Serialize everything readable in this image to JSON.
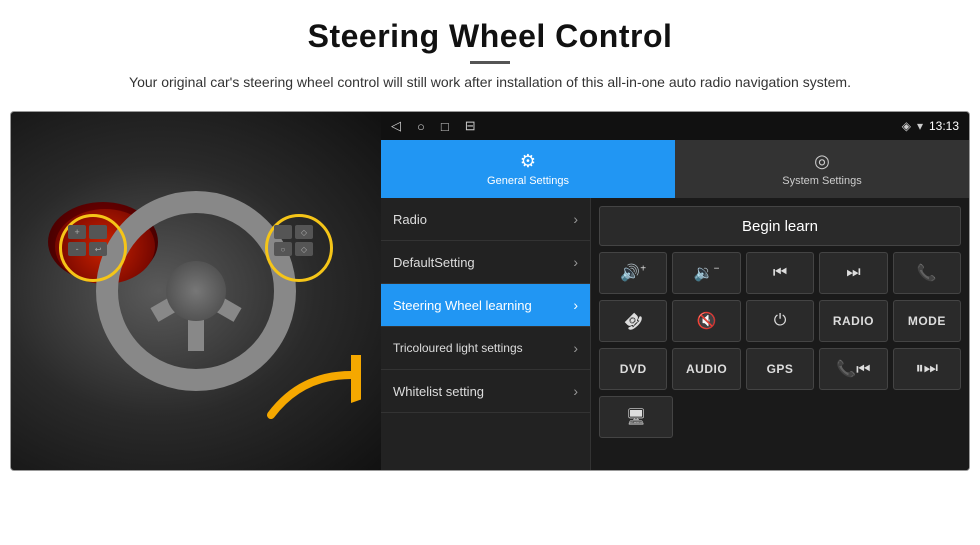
{
  "header": {
    "title": "Steering Wheel Control",
    "divider": true,
    "subtitle": "Your original car's steering wheel control will still work after installation of this all-in-one auto radio navigation system."
  },
  "statusBar": {
    "navIcons": [
      "◁",
      "○",
      "□",
      "⊟"
    ],
    "rightIcons": [
      "♦",
      "▾",
      "13:13"
    ],
    "gpsIcon": "◈"
  },
  "tabs": [
    {
      "id": "general",
      "icon": "⚙",
      "label": "General Settings",
      "active": true
    },
    {
      "id": "system",
      "icon": "◎",
      "label": "System Settings",
      "active": false
    }
  ],
  "menuItems": [
    {
      "id": "radio",
      "label": "Radio",
      "active": false
    },
    {
      "id": "default-setting",
      "label": "DefaultSetting",
      "active": false
    },
    {
      "id": "steering-wheel",
      "label": "Steering Wheel learning",
      "active": true
    },
    {
      "id": "tricoloured",
      "label": "Tricoloured light settings",
      "active": false
    },
    {
      "id": "whitelist",
      "label": "Whitelist setting",
      "active": false
    }
  ],
  "controls": {
    "beginLearn": "Begin learn",
    "row1": [
      "🔊+",
      "🔊-",
      "⏮",
      "⏭",
      "📞"
    ],
    "row2": [
      "☎",
      "🔇",
      "⏻",
      "RADIO",
      "MODE"
    ],
    "row3": [
      "DVD",
      "AUDIO",
      "GPS",
      "📞⏮",
      "⏸⏭"
    ],
    "row4": [
      "🖥"
    ]
  },
  "buttonLabels": {
    "volUp": "◀|+",
    "volDown": "◀|-",
    "prevTrack": "⏮⏮",
    "nextTrack": "⏭⏭",
    "phone": "☎",
    "hangup": "↩",
    "mute": "🔇×",
    "power": "⏻",
    "radio": "RADIO",
    "mode": "MODE",
    "dvd": "DVD",
    "audio": "AUDIO",
    "gps": "GPS",
    "phoneBack": "☎⏮",
    "fastFwd": "⏸⏭",
    "screen": "🖵"
  }
}
